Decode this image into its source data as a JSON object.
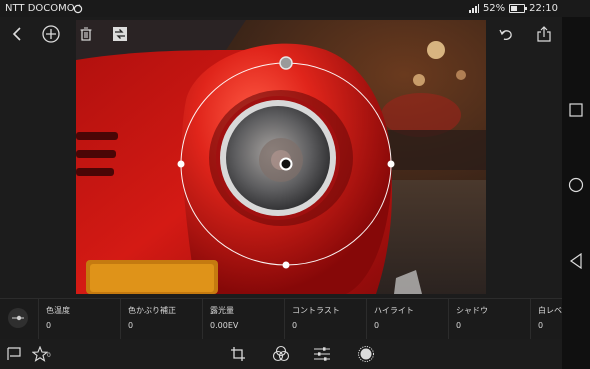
{
  "status_bar": {
    "carrier": "NTT DOCOMO",
    "battery": "52%",
    "time": "22:10",
    "battery_level": 0.52
  },
  "toolbar": {
    "icons": [
      "back-icon",
      "add-icon",
      "trash-icon",
      "compare-icon",
      "undo-icon",
      "share-icon"
    ]
  },
  "adjustments": [
    {
      "label": "色温度",
      "value": "0"
    },
    {
      "label": "色かぶり補正",
      "value": "0"
    },
    {
      "label": "露光量",
      "value": "0.00EV"
    },
    {
      "label": "コントラスト",
      "value": "0"
    },
    {
      "label": "ハイライト",
      "value": "0"
    },
    {
      "label": "シャドウ",
      "value": "0"
    },
    {
      "label": "白レベ",
      "value": "0"
    }
  ],
  "bottom_bar": {
    "star_count": "0",
    "icons": [
      "flag-icon",
      "star-icon",
      "crop-icon",
      "color-mix-icon",
      "sliders-icon",
      "radial-filter-icon"
    ]
  },
  "nav_bar": {
    "icons": [
      "recent-apps-icon",
      "home-icon",
      "nav-back-icon"
    ]
  }
}
